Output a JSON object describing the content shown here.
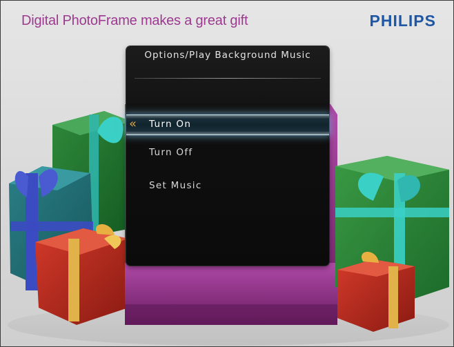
{
  "header": {
    "tagline": "Digital PhotoFrame makes a great gift",
    "brand": "PHILIPS"
  },
  "menu": {
    "title": "Options/Play Background Music",
    "items": [
      {
        "label": "Turn On",
        "selected": true
      },
      {
        "label": "Turn Off",
        "selected": false
      },
      {
        "label": "Set Music",
        "selected": false
      }
    ],
    "selection_indicator": "double-chevron-left-icon"
  },
  "colors": {
    "tagline": "#9b3a8f",
    "brand": "#1f57a5",
    "panel_bg": "#0f0f0f",
    "highlight_glow": "#82d2ff",
    "chevron": "#e0a73c"
  }
}
